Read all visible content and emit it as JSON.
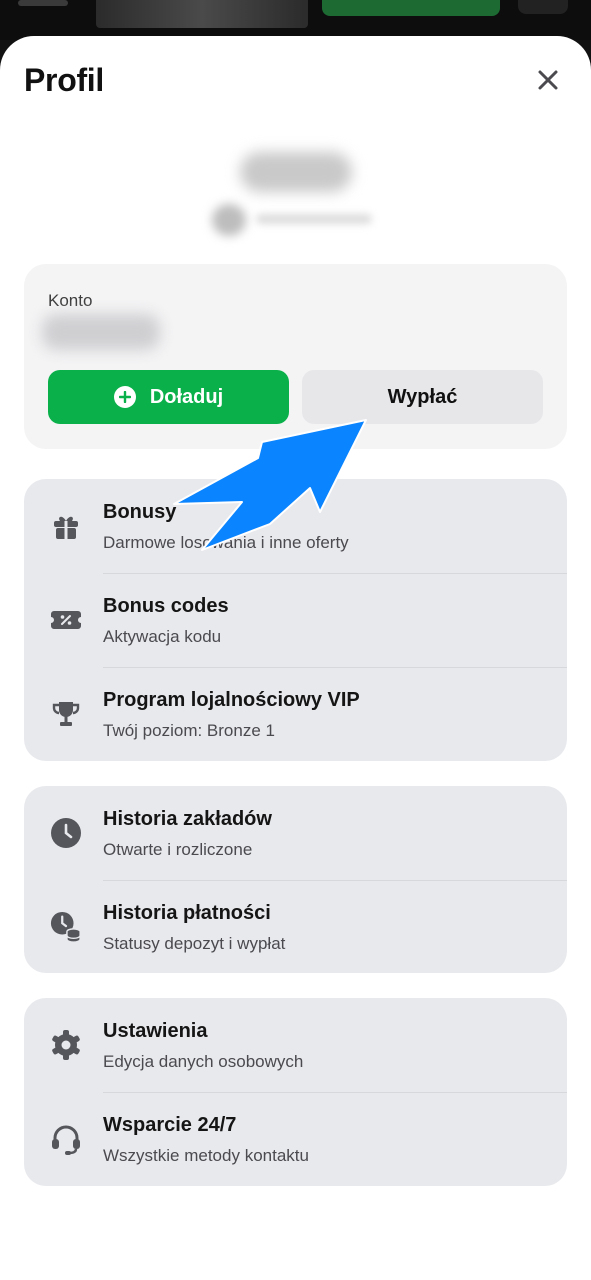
{
  "header": {
    "title": "Profil"
  },
  "account": {
    "label": "Konto",
    "topup_label": "Doładuj",
    "withdraw_label": "Wypłać",
    "topup_color": "#0ab04a"
  },
  "menu_groups": [
    {
      "items": [
        {
          "icon": "gift-icon",
          "title": "Bonusy",
          "subtitle": "Darmowe losowania i inne oferty"
        },
        {
          "icon": "coupon-icon",
          "title": "Bonus codes",
          "subtitle": "Aktywacja kodu"
        },
        {
          "icon": "trophy-icon",
          "title": "Program lojalnościowy VIP",
          "subtitle": "Twój poziom: Bronze 1"
        }
      ]
    },
    {
      "items": [
        {
          "icon": "clock-icon",
          "title": "Historia zakładów",
          "subtitle": "Otwarte i rozliczone"
        },
        {
          "icon": "payment-history-icon",
          "title": "Historia płatności",
          "subtitle": "Statusy depozyt i wypłat"
        }
      ]
    },
    {
      "items": [
        {
          "icon": "gear-icon",
          "title": "Ustawienia",
          "subtitle": "Edycja danych osobowych"
        },
        {
          "icon": "headset-icon",
          "title": "Wsparcie 24/7",
          "subtitle": "Wszystkie metody kontaktu"
        }
      ]
    }
  ],
  "annotation": {
    "arrow_color": "#0a84ff"
  }
}
